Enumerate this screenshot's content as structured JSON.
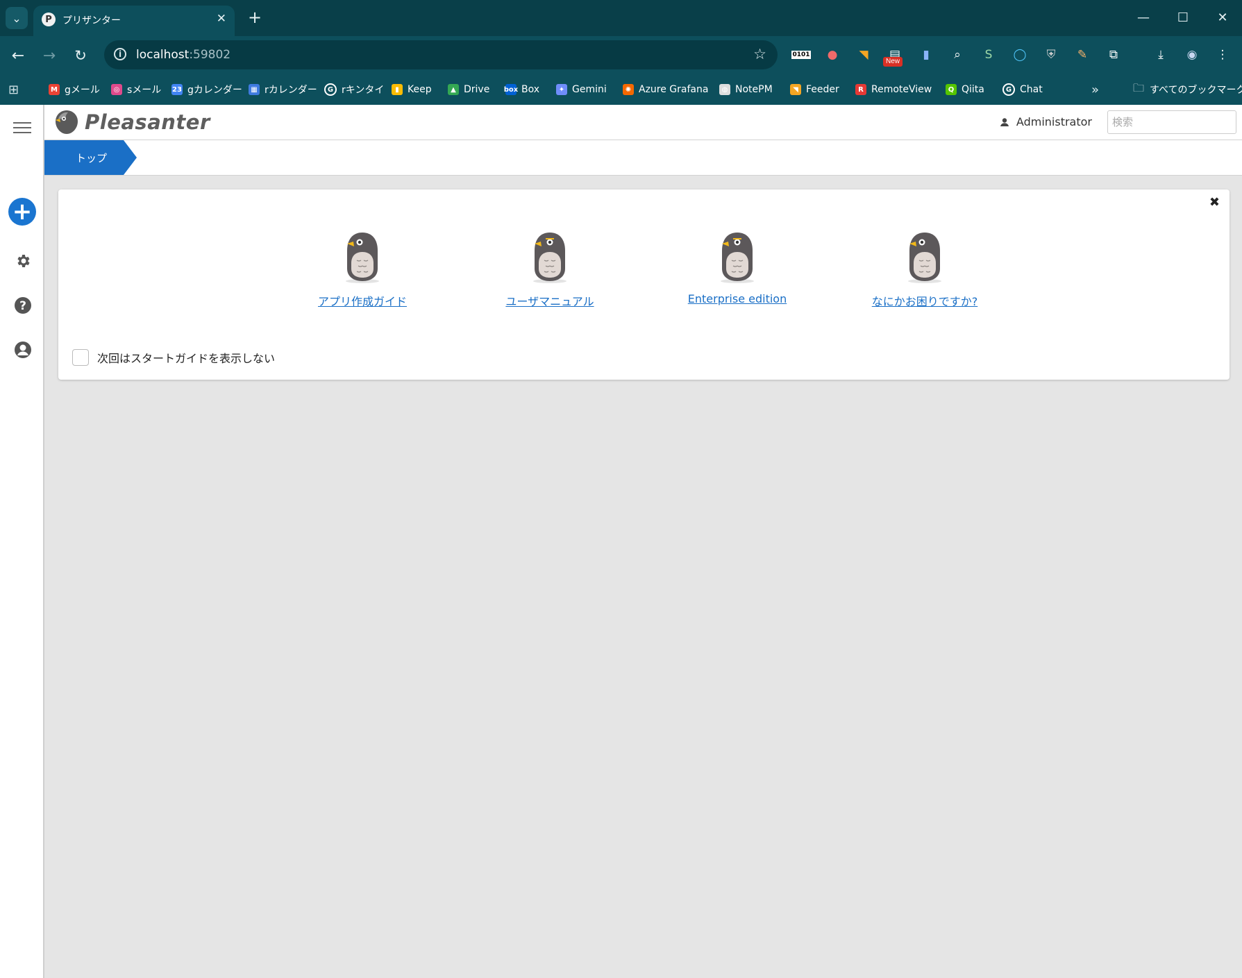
{
  "browser": {
    "tab_title": "プリザンター",
    "favicon_letter": "P",
    "url_host": "localhost",
    "url_port": ":59802",
    "extensions": [
      {
        "name": "binary-ext-icon",
        "glyph": "0101",
        "color": "#000000"
      },
      {
        "name": "asana-ext-icon",
        "glyph": "●",
        "color": "#f06a6a"
      },
      {
        "name": "rss-ext-icon",
        "glyph": "◥",
        "color": "#f5a623"
      },
      {
        "name": "new-ext-icon",
        "glyph": "▤",
        "color": "#ffffff",
        "badge": "New"
      },
      {
        "name": "docs-ext-icon",
        "glyph": "▮",
        "color": "#8ab4f8"
      },
      {
        "name": "search-doc-ext-icon",
        "glyph": "⌕",
        "color": "#ffffff"
      },
      {
        "name": "s-ext-icon",
        "glyph": "S",
        "color": "#9ed9a8"
      },
      {
        "name": "circle-ext-icon",
        "glyph": "◯",
        "color": "#4fc3f7"
      },
      {
        "name": "shield-ext-icon",
        "glyph": "⛨",
        "color": "#d0d0d0"
      },
      {
        "name": "pen-ext-icon",
        "glyph": "✎",
        "color": "#f6b26b"
      },
      {
        "name": "puzzle-ext-icon",
        "glyph": "⧉",
        "color": "#ffffff"
      },
      {
        "name": "download-icon",
        "glyph": "⤓",
        "color": "#ffffff"
      },
      {
        "name": "profile-avatar-icon",
        "glyph": "◉",
        "color": "#c9d7f0"
      },
      {
        "name": "browser-menu-icon",
        "glyph": "⋮",
        "color": "#ffffff"
      }
    ],
    "bookmarks": [
      {
        "label": "gメール",
        "icon": "M",
        "color": "#ea4335"
      },
      {
        "label": "sメール",
        "icon": "◎",
        "color": "#e04a8c"
      },
      {
        "label": "gカレンダー",
        "icon": "23",
        "color": "#4285f4"
      },
      {
        "label": "rカレンダー",
        "icon": "▦",
        "color": "#3f7be0"
      },
      {
        "label": "rキンタイ",
        "icon": "G",
        "color": "#ffffff"
      },
      {
        "label": "Keep",
        "icon": "▮",
        "color": "#fbbc04"
      },
      {
        "label": "Drive",
        "icon": "▲",
        "color": "#34a853"
      },
      {
        "label": "Box",
        "icon": "box",
        "color": "#0061d5"
      },
      {
        "label": "Gemini",
        "icon": "✦",
        "color": "#6f8dfb"
      },
      {
        "label": "Azure Grafana",
        "icon": "✺",
        "color": "#f46800"
      },
      {
        "label": "NotePM",
        "icon": "◍",
        "color": "#dddddd"
      },
      {
        "label": "Feeder",
        "icon": "◥",
        "color": "#f5a623"
      },
      {
        "label": "RemoteView",
        "icon": "R",
        "color": "#e53935"
      },
      {
        "label": "Qiita",
        "icon": "Q",
        "color": "#55c500"
      },
      {
        "label": "Chat",
        "icon": "G",
        "color": "#ffffff"
      }
    ],
    "all_bookmarks_label": "すべてのブックマーク"
  },
  "app": {
    "logo_text": "Pleasanter",
    "user_name": "Administrator",
    "search_placeholder": "検索",
    "breadcrumb": "トップ"
  },
  "guide": {
    "items": [
      {
        "label": "アプリ作成ガイド",
        "eye": "left"
      },
      {
        "label": "ユーザマニュアル",
        "eye": "front"
      },
      {
        "label": "Enterprise edition",
        "eye": "front"
      },
      {
        "label": "なにかお困りですか?",
        "eye": "left"
      }
    ],
    "checkbox_label": "次回はスタートガイドを表示しない",
    "close_glyph": "✖"
  },
  "colors": {
    "chrome_bg": "#0d4f5c",
    "accent": "#1a6fc6",
    "plus_button": "#1a75d0"
  }
}
